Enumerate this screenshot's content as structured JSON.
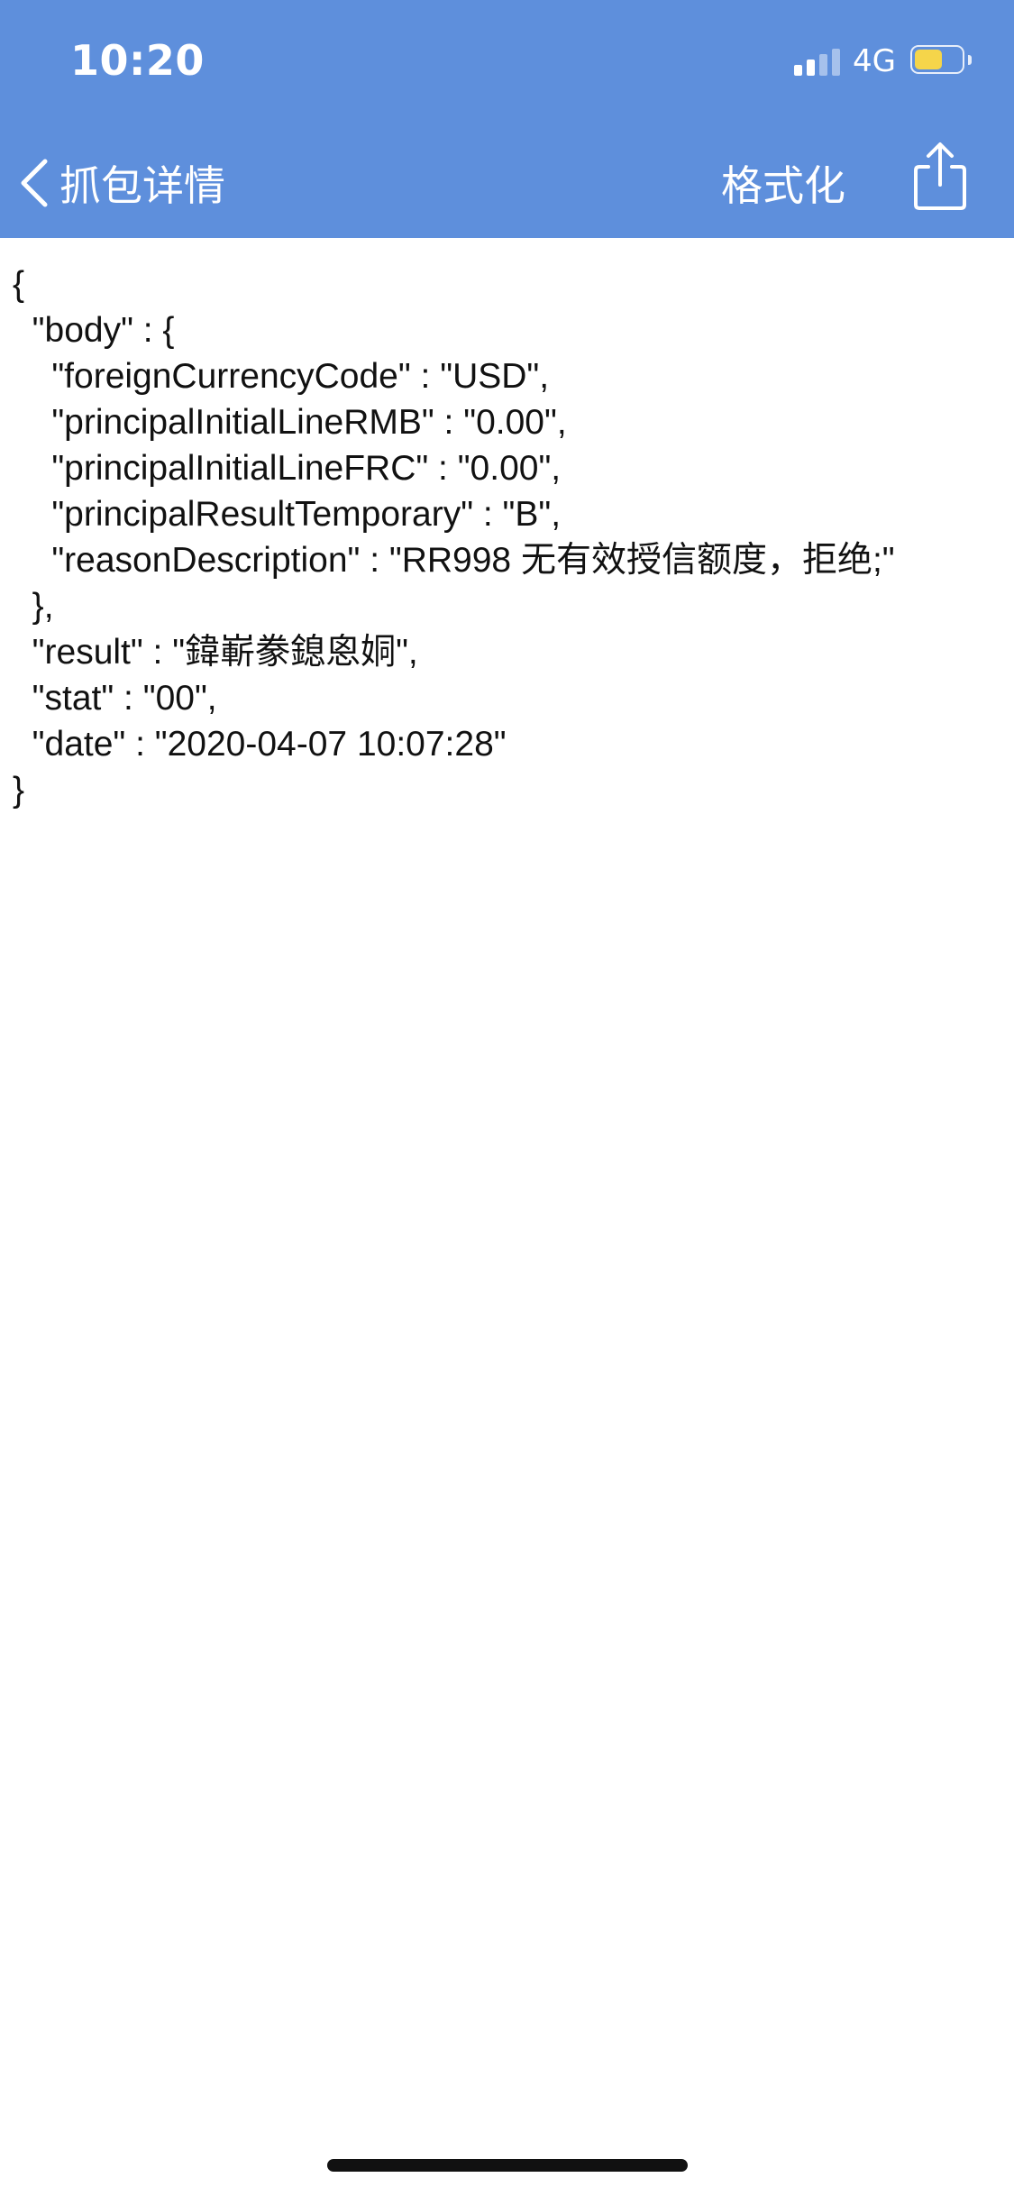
{
  "status_bar": {
    "time": "10:20",
    "network": "4G",
    "battery_level": 0.6,
    "battery_color": "#f5d54a"
  },
  "nav": {
    "back_label": "抓包详情",
    "format_label": "格式化",
    "share_icon": "share-icon",
    "background_color": "#5e8fdc"
  },
  "json_lines": [
    "{",
    "  \"body\" : {",
    "    \"foreignCurrencyCode\" : \"USD\",",
    "    \"principalInitialLineRMB\" : \"0.00\",",
    "    \"principalInitialLineFRC\" : \"0.00\",",
    "    \"principalResultTemporary\" : \"B\",",
    "    \"reasonDescription\" : \"RR998 无有效授信额度，拒绝;\"",
    "  },",
    "  \"result\" : \"鍏嶄豢鎴恖姛\",",
    "  \"stat\" : \"00\",",
    "  \"date\" : \"2020-04-07 10:07:28\"",
    "}"
  ]
}
